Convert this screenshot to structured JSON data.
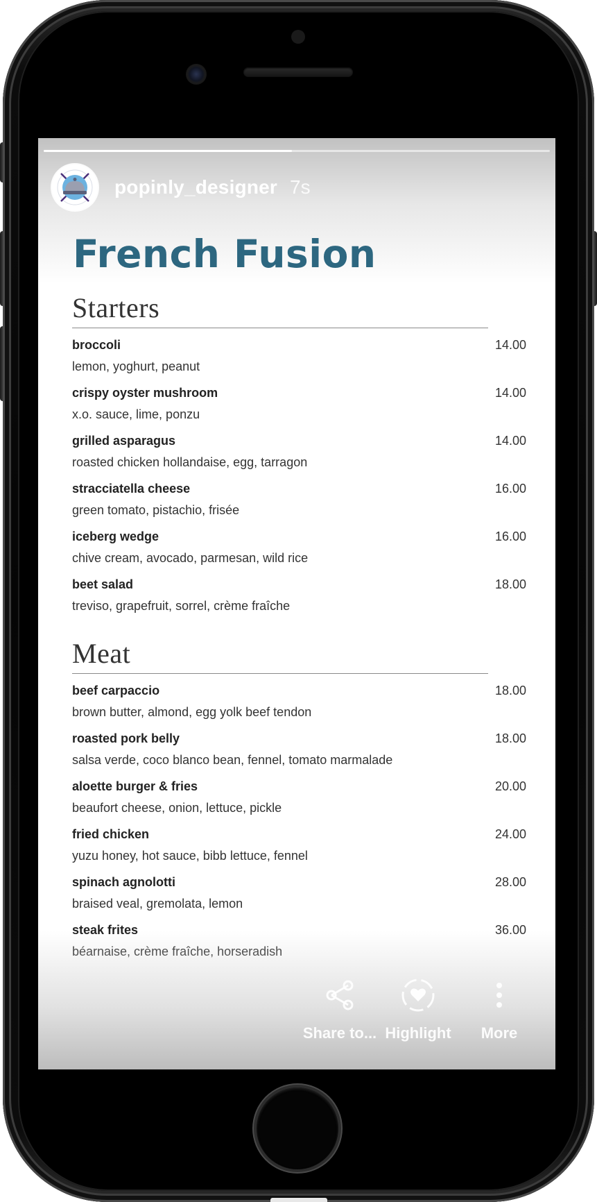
{
  "story": {
    "username": "popinly_designer",
    "time_ago": "7s",
    "progress": 0.49,
    "avatar_icon": "service-bell-icon"
  },
  "menu": {
    "title": "French Fusion",
    "sections": [
      {
        "title": "Starters",
        "items": [
          {
            "name": "broccoli",
            "desc": "lemon, yoghurt, peanut",
            "price": "14.00"
          },
          {
            "name": "crispy oyster mushroom",
            "desc": "x.o. sauce, lime, ponzu",
            "price": "14.00"
          },
          {
            "name": "grilled asparagus",
            "desc": "roasted chicken hollandaise, egg, tarragon",
            "price": "14.00"
          },
          {
            "name": "stracciatella cheese",
            "desc": "green tomato, pistachio, frisée",
            "price": "16.00"
          },
          {
            "name": "iceberg wedge",
            "desc": "chive cream, avocado, parmesan, wild rice",
            "price": "16.00"
          },
          {
            "name": "beet salad",
            "desc": "treviso, grapefruit, sorrel, crème fraîche",
            "price": "18.00"
          }
        ]
      },
      {
        "title": "Meat",
        "items": [
          {
            "name": "beef carpaccio",
            "desc": "brown butter, almond, egg yolk beef tendon",
            "price": "18.00"
          },
          {
            "name": "roasted pork belly",
            "desc": "salsa verde, coco blanco bean, fennel, tomato marmalade",
            "price": "18.00"
          },
          {
            "name": "aloette burger & fries",
            "desc": "beaufort cheese, onion, lettuce, pickle",
            "price": "20.00"
          },
          {
            "name": "fried chicken",
            "desc": "yuzu honey, hot sauce, bibb lettuce, fennel",
            "price": "24.00"
          },
          {
            "name": "spinach agnolotti",
            "desc": "braised veal, gremolata, lemon",
            "price": "28.00"
          },
          {
            "name": "steak frites",
            "desc": "béarnaise, crème fraîche, horseradish",
            "price": "36.00"
          }
        ]
      }
    ]
  },
  "actions": {
    "share": {
      "label": "Share to...",
      "icon": "share-icon"
    },
    "highlight": {
      "label": "Highlight",
      "icon": "highlight-heart-icon"
    },
    "more": {
      "label": "More",
      "icon": "more-vertical-icon"
    }
  },
  "colors": {
    "title": "#2d6780",
    "text": "#333333",
    "rule": "#8a8a8a"
  }
}
